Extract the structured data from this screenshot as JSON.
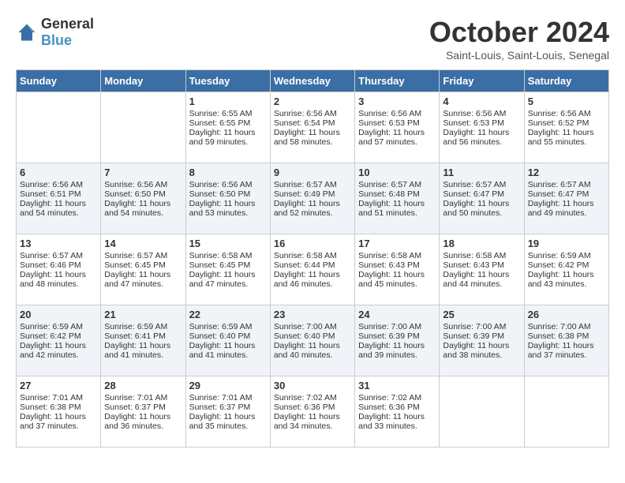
{
  "header": {
    "logo_general": "General",
    "logo_blue": "Blue",
    "month_title": "October 2024",
    "location": "Saint-Louis, Saint-Louis, Senegal"
  },
  "days_of_week": [
    "Sunday",
    "Monday",
    "Tuesday",
    "Wednesday",
    "Thursday",
    "Friday",
    "Saturday"
  ],
  "weeks": [
    [
      {
        "day": "",
        "sunrise": "",
        "sunset": "",
        "daylight": ""
      },
      {
        "day": "",
        "sunrise": "",
        "sunset": "",
        "daylight": ""
      },
      {
        "day": "1",
        "sunrise": "Sunrise: 6:55 AM",
        "sunset": "Sunset: 6:55 PM",
        "daylight": "Daylight: 11 hours and 59 minutes."
      },
      {
        "day": "2",
        "sunrise": "Sunrise: 6:56 AM",
        "sunset": "Sunset: 6:54 PM",
        "daylight": "Daylight: 11 hours and 58 minutes."
      },
      {
        "day": "3",
        "sunrise": "Sunrise: 6:56 AM",
        "sunset": "Sunset: 6:53 PM",
        "daylight": "Daylight: 11 hours and 57 minutes."
      },
      {
        "day": "4",
        "sunrise": "Sunrise: 6:56 AM",
        "sunset": "Sunset: 6:53 PM",
        "daylight": "Daylight: 11 hours and 56 minutes."
      },
      {
        "day": "5",
        "sunrise": "Sunrise: 6:56 AM",
        "sunset": "Sunset: 6:52 PM",
        "daylight": "Daylight: 11 hours and 55 minutes."
      }
    ],
    [
      {
        "day": "6",
        "sunrise": "Sunrise: 6:56 AM",
        "sunset": "Sunset: 6:51 PM",
        "daylight": "Daylight: 11 hours and 54 minutes."
      },
      {
        "day": "7",
        "sunrise": "Sunrise: 6:56 AM",
        "sunset": "Sunset: 6:50 PM",
        "daylight": "Daylight: 11 hours and 54 minutes."
      },
      {
        "day": "8",
        "sunrise": "Sunrise: 6:56 AM",
        "sunset": "Sunset: 6:50 PM",
        "daylight": "Daylight: 11 hours and 53 minutes."
      },
      {
        "day": "9",
        "sunrise": "Sunrise: 6:57 AM",
        "sunset": "Sunset: 6:49 PM",
        "daylight": "Daylight: 11 hours and 52 minutes."
      },
      {
        "day": "10",
        "sunrise": "Sunrise: 6:57 AM",
        "sunset": "Sunset: 6:48 PM",
        "daylight": "Daylight: 11 hours and 51 minutes."
      },
      {
        "day": "11",
        "sunrise": "Sunrise: 6:57 AM",
        "sunset": "Sunset: 6:47 PM",
        "daylight": "Daylight: 11 hours and 50 minutes."
      },
      {
        "day": "12",
        "sunrise": "Sunrise: 6:57 AM",
        "sunset": "Sunset: 6:47 PM",
        "daylight": "Daylight: 11 hours and 49 minutes."
      }
    ],
    [
      {
        "day": "13",
        "sunrise": "Sunrise: 6:57 AM",
        "sunset": "Sunset: 6:46 PM",
        "daylight": "Daylight: 11 hours and 48 minutes."
      },
      {
        "day": "14",
        "sunrise": "Sunrise: 6:57 AM",
        "sunset": "Sunset: 6:45 PM",
        "daylight": "Daylight: 11 hours and 47 minutes."
      },
      {
        "day": "15",
        "sunrise": "Sunrise: 6:58 AM",
        "sunset": "Sunset: 6:45 PM",
        "daylight": "Daylight: 11 hours and 47 minutes."
      },
      {
        "day": "16",
        "sunrise": "Sunrise: 6:58 AM",
        "sunset": "Sunset: 6:44 PM",
        "daylight": "Daylight: 11 hours and 46 minutes."
      },
      {
        "day": "17",
        "sunrise": "Sunrise: 6:58 AM",
        "sunset": "Sunset: 6:43 PM",
        "daylight": "Daylight: 11 hours and 45 minutes."
      },
      {
        "day": "18",
        "sunrise": "Sunrise: 6:58 AM",
        "sunset": "Sunset: 6:43 PM",
        "daylight": "Daylight: 11 hours and 44 minutes."
      },
      {
        "day": "19",
        "sunrise": "Sunrise: 6:59 AM",
        "sunset": "Sunset: 6:42 PM",
        "daylight": "Daylight: 11 hours and 43 minutes."
      }
    ],
    [
      {
        "day": "20",
        "sunrise": "Sunrise: 6:59 AM",
        "sunset": "Sunset: 6:42 PM",
        "daylight": "Daylight: 11 hours and 42 minutes."
      },
      {
        "day": "21",
        "sunrise": "Sunrise: 6:59 AM",
        "sunset": "Sunset: 6:41 PM",
        "daylight": "Daylight: 11 hours and 41 minutes."
      },
      {
        "day": "22",
        "sunrise": "Sunrise: 6:59 AM",
        "sunset": "Sunset: 6:40 PM",
        "daylight": "Daylight: 11 hours and 41 minutes."
      },
      {
        "day": "23",
        "sunrise": "Sunrise: 7:00 AM",
        "sunset": "Sunset: 6:40 PM",
        "daylight": "Daylight: 11 hours and 40 minutes."
      },
      {
        "day": "24",
        "sunrise": "Sunrise: 7:00 AM",
        "sunset": "Sunset: 6:39 PM",
        "daylight": "Daylight: 11 hours and 39 minutes."
      },
      {
        "day": "25",
        "sunrise": "Sunrise: 7:00 AM",
        "sunset": "Sunset: 6:39 PM",
        "daylight": "Daylight: 11 hours and 38 minutes."
      },
      {
        "day": "26",
        "sunrise": "Sunrise: 7:00 AM",
        "sunset": "Sunset: 6:38 PM",
        "daylight": "Daylight: 11 hours and 37 minutes."
      }
    ],
    [
      {
        "day": "27",
        "sunrise": "Sunrise: 7:01 AM",
        "sunset": "Sunset: 6:38 PM",
        "daylight": "Daylight: 11 hours and 37 minutes."
      },
      {
        "day": "28",
        "sunrise": "Sunrise: 7:01 AM",
        "sunset": "Sunset: 6:37 PM",
        "daylight": "Daylight: 11 hours and 36 minutes."
      },
      {
        "day": "29",
        "sunrise": "Sunrise: 7:01 AM",
        "sunset": "Sunset: 6:37 PM",
        "daylight": "Daylight: 11 hours and 35 minutes."
      },
      {
        "day": "30",
        "sunrise": "Sunrise: 7:02 AM",
        "sunset": "Sunset: 6:36 PM",
        "daylight": "Daylight: 11 hours and 34 minutes."
      },
      {
        "day": "31",
        "sunrise": "Sunrise: 7:02 AM",
        "sunset": "Sunset: 6:36 PM",
        "daylight": "Daylight: 11 hours and 33 minutes."
      },
      {
        "day": "",
        "sunrise": "",
        "sunset": "",
        "daylight": ""
      },
      {
        "day": "",
        "sunrise": "",
        "sunset": "",
        "daylight": ""
      }
    ]
  ]
}
